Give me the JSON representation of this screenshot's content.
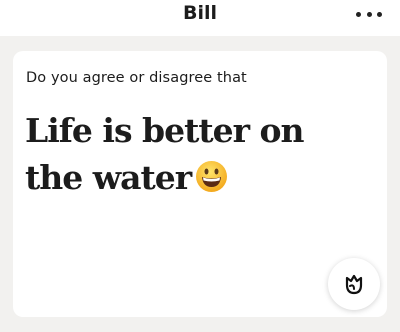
{
  "header": {
    "title": "Bill",
    "more_icon": "more-horizontal-icon"
  },
  "prompt": {
    "label": "Do you agree or disagree that",
    "answer": "Life is better on the water",
    "emoji_icon": "grinning-face-emoji"
  },
  "like_button": {
    "icon": "rose-icon"
  }
}
